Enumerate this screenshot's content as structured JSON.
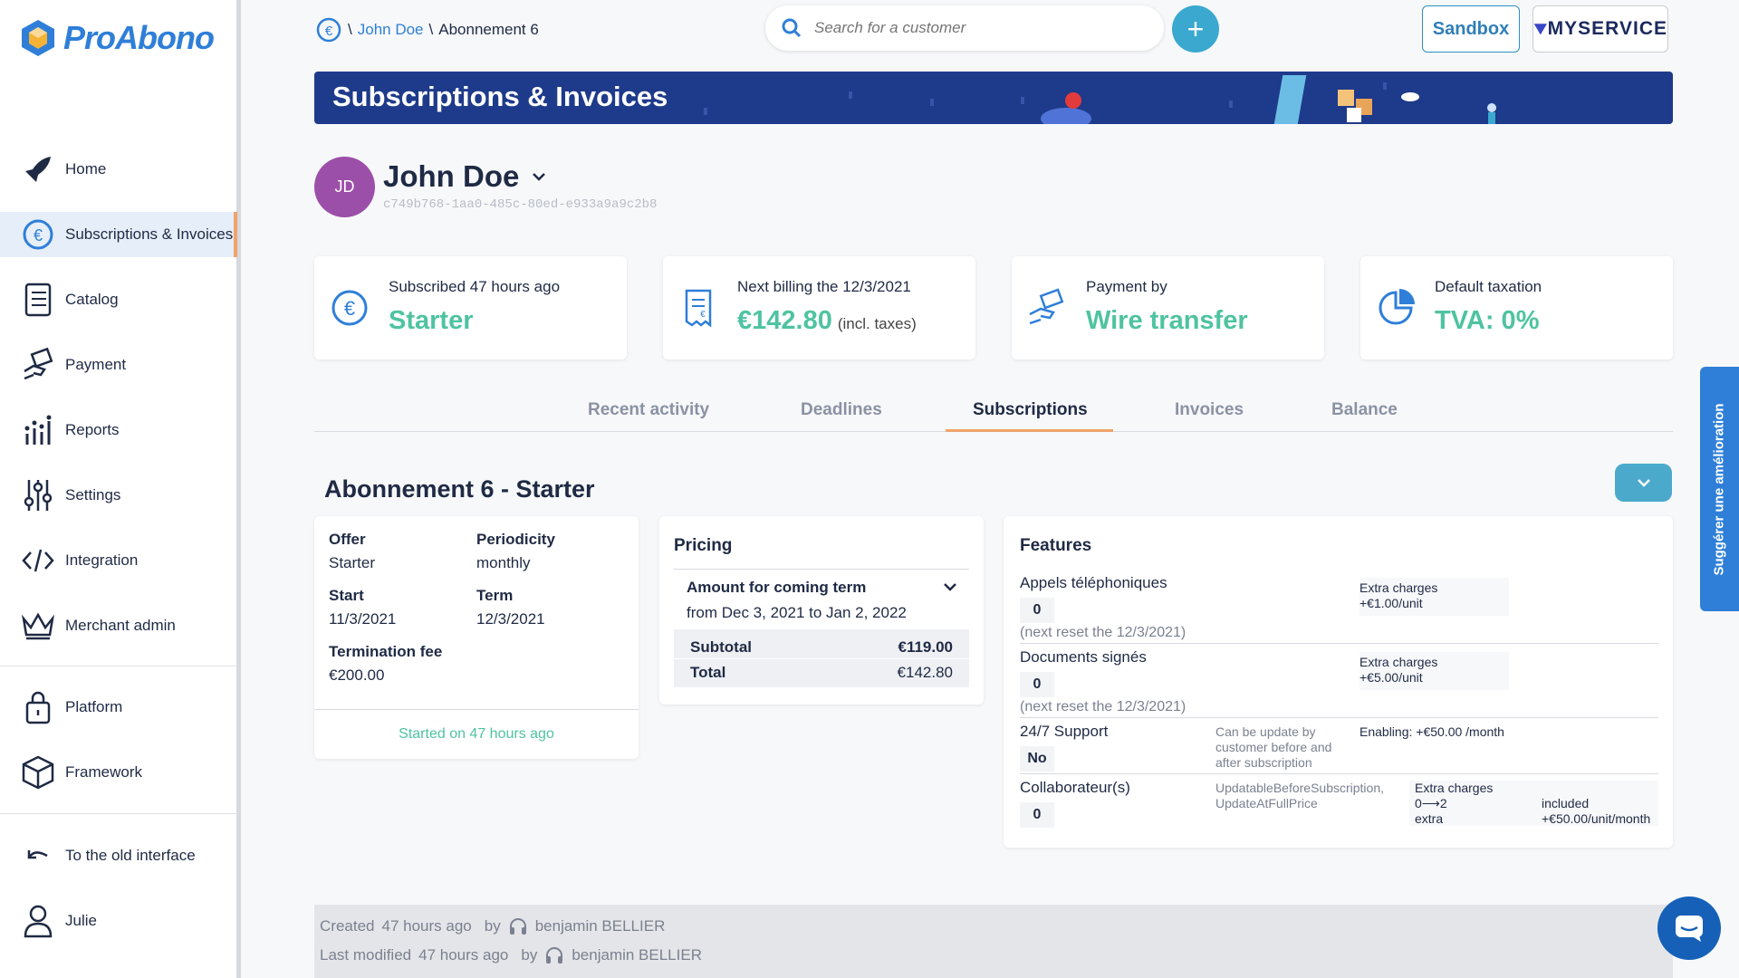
{
  "app": {
    "logo_text": "ProAbono"
  },
  "sidebar": {
    "items": [
      {
        "label": "Home",
        "icon": "rocket-icon"
      },
      {
        "label": "Subscriptions & Invoices",
        "icon": "euro-icon"
      },
      {
        "label": "Catalog",
        "icon": "catalog-icon"
      },
      {
        "label": "Payment",
        "icon": "payment-icon"
      },
      {
        "label": "Reports",
        "icon": "reports-icon"
      },
      {
        "label": "Settings",
        "icon": "settings-icon"
      },
      {
        "label": "Integration",
        "icon": "code-icon"
      },
      {
        "label": "Merchant admin",
        "icon": "crown-icon"
      },
      {
        "label": "Platform",
        "icon": "lock-icon"
      },
      {
        "label": "Framework",
        "icon": "cube-icon"
      },
      {
        "label": "To the old interface",
        "icon": "undo-icon"
      },
      {
        "label": "Julie",
        "icon": "user-icon"
      }
    ]
  },
  "header": {
    "breadcrumb": {
      "customer": "John Doe",
      "separator": "\\",
      "current": "Abonnement 6"
    },
    "search_placeholder": "Search for a customer",
    "add_label": "+",
    "sandbox_label": "Sandbox",
    "merchant_logo_text": "MYSERVICE"
  },
  "banner": {
    "title": "Subscriptions & Invoices"
  },
  "customer": {
    "initials": "JD",
    "name": "John Doe",
    "id": "c749b768-1aa0-485c-80ed-e933a9a9c2b8"
  },
  "cards": {
    "subscribed": {
      "label": "Subscribed 47 hours ago",
      "value": "Starter"
    },
    "billing": {
      "label": "Next billing the 12/3/2021",
      "value": "€142.80",
      "note": "(incl. taxes)"
    },
    "payment": {
      "label": "Payment by",
      "value": "Wire transfer"
    },
    "taxation": {
      "label": "Default taxation",
      "value": "TVA: 0%"
    }
  },
  "tabs": [
    "Recent activity",
    "Deadlines",
    "Subscriptions",
    "Invoices",
    "Balance"
  ],
  "subscription": {
    "title": "Abonnement 6 - Starter",
    "details": {
      "offer_label": "Offer",
      "offer": "Starter",
      "periodicity_label": "Periodicity",
      "periodicity": "monthly",
      "start_label": "Start",
      "start": "11/3/2021",
      "term_label": "Term",
      "term": "12/3/2021",
      "fee_label": "Termination fee",
      "fee": "€200.00",
      "started": "Started on 47 hours ago"
    },
    "pricing": {
      "title": "Pricing",
      "amount_label": "Amount for coming term",
      "period": "from Dec 3, 2021 to Jan 2, 2022",
      "subtotal_label": "Subtotal",
      "subtotal": "€119.00",
      "total_label": "Total",
      "total": "€142.80"
    },
    "features": {
      "title": "Features",
      "rows": [
        {
          "name": "Appels téléphoniques",
          "qty": "0",
          "reset": "(next reset the 12/3/2021)",
          "extra_label": "Extra charges",
          "extra_value": "+€1.00/unit"
        },
        {
          "name": "Documents signés",
          "qty": "0",
          "reset": "(next reset the 12/3/2021)",
          "extra_label": "Extra charges",
          "extra_value": "+€5.00/unit"
        },
        {
          "name": "24/7 Support",
          "qty": "No",
          "note": "Can be update by customer before and after subscription",
          "enabling_label": "Enabling:",
          "enabling_value": "+€50.00",
          "enabling_period": "/month"
        },
        {
          "name": "Collaborateur(s)",
          "qty": "0",
          "note": "UpdatableBeforeSubscription, UpdateAtFullPrice",
          "extra_label": "Extra charges",
          "range": "0⟶2",
          "range_label": "extra",
          "included": "included",
          "included_value": "+€50.00/unit/month"
        }
      ]
    }
  },
  "footer": {
    "created_label": "Created",
    "created_time": "47 hours ago",
    "by": "by",
    "created_by": "benjamin BELLIER",
    "modified_label": "Last modified",
    "modified_time": "47 hours ago",
    "modified_by": "benjamin BELLIER"
  },
  "side_widget": {
    "suggest_label": "Suggérer une amélioration"
  },
  "colors": {
    "accent": "#2f7fd8",
    "green": "#4fc3a1",
    "banner": "#1e3a8a",
    "orange": "#f0a36a"
  }
}
